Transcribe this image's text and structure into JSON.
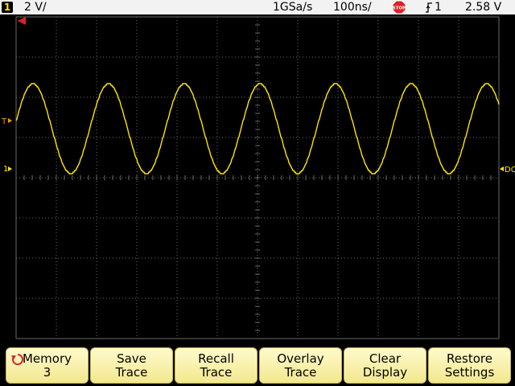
{
  "colors": {
    "trace": "#ffe600",
    "grid": "#6a6a6a",
    "marker_red": "#e0202a",
    "marker_orange": "#ff9900",
    "background": "#000000"
  },
  "status_bar": {
    "channel_number": "1",
    "volts_per_div": "2 V/",
    "sample_rate": "1GSa/s",
    "time_per_div": "100ns/",
    "run_state_label": "STOP",
    "trigger_source": "1",
    "trigger_level": "2.58 V"
  },
  "markers": {
    "channel_ground": "1",
    "right_edge_label": "DC"
  },
  "softkeys": [
    {
      "line1": "Memory",
      "line2": "3",
      "icon": "rotate-arrow-icon"
    },
    {
      "line1": "Save",
      "line2": "Trace"
    },
    {
      "line1": "Recall",
      "line2": "Trace"
    },
    {
      "line1": "Overlay",
      "line2": "Trace"
    },
    {
      "line1": "Clear",
      "line2": "Display"
    },
    {
      "line1": "Restore",
      "line2": "Settings"
    }
  ]
}
